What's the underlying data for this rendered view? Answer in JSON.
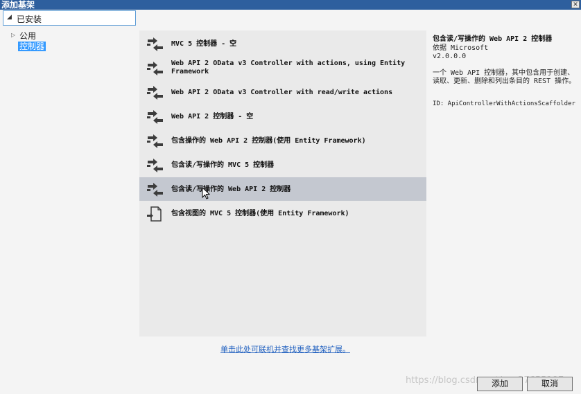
{
  "window": {
    "title": "添加基架"
  },
  "tree": {
    "installed": "已安装",
    "common": "公用",
    "controller": "控制器"
  },
  "scaffolders": [
    {
      "label": "MVC 5 控制器 - 空"
    },
    {
      "label": "Web API 2 OData v3 Controller with actions, using Entity Framework"
    },
    {
      "label": "Web API 2 OData v3 Controller with read/write actions"
    },
    {
      "label": "Web API 2 控制器 - 空"
    },
    {
      "label": "包含操作的 Web API 2 控制器(使用 Entity Framework)"
    },
    {
      "label": "包含读/写操作的 MVC 5 控制器"
    },
    {
      "label": "包含读/写操作的 Web API 2 控制器"
    },
    {
      "label": "包含视图的 MVC 5 控制器(使用 Entity Framework)"
    }
  ],
  "details": {
    "title": "包含读/写操作的 Web API 2 控制器",
    "by": "依据 Microsoft",
    "version": "v2.0.0.0",
    "description": "一个 Web API 控制器，其中包含用于创建、读取、更新、删除和列出条目的 REST 操作。",
    "id": "ID: ApiControllerWithActionsScaffolder"
  },
  "online_link": "单击此处可联机并查找更多基架扩展。",
  "buttons": {
    "add": "添加",
    "cancel": "取消"
  },
  "watermark": "https://blog.csdn.net/qq_27655197"
}
